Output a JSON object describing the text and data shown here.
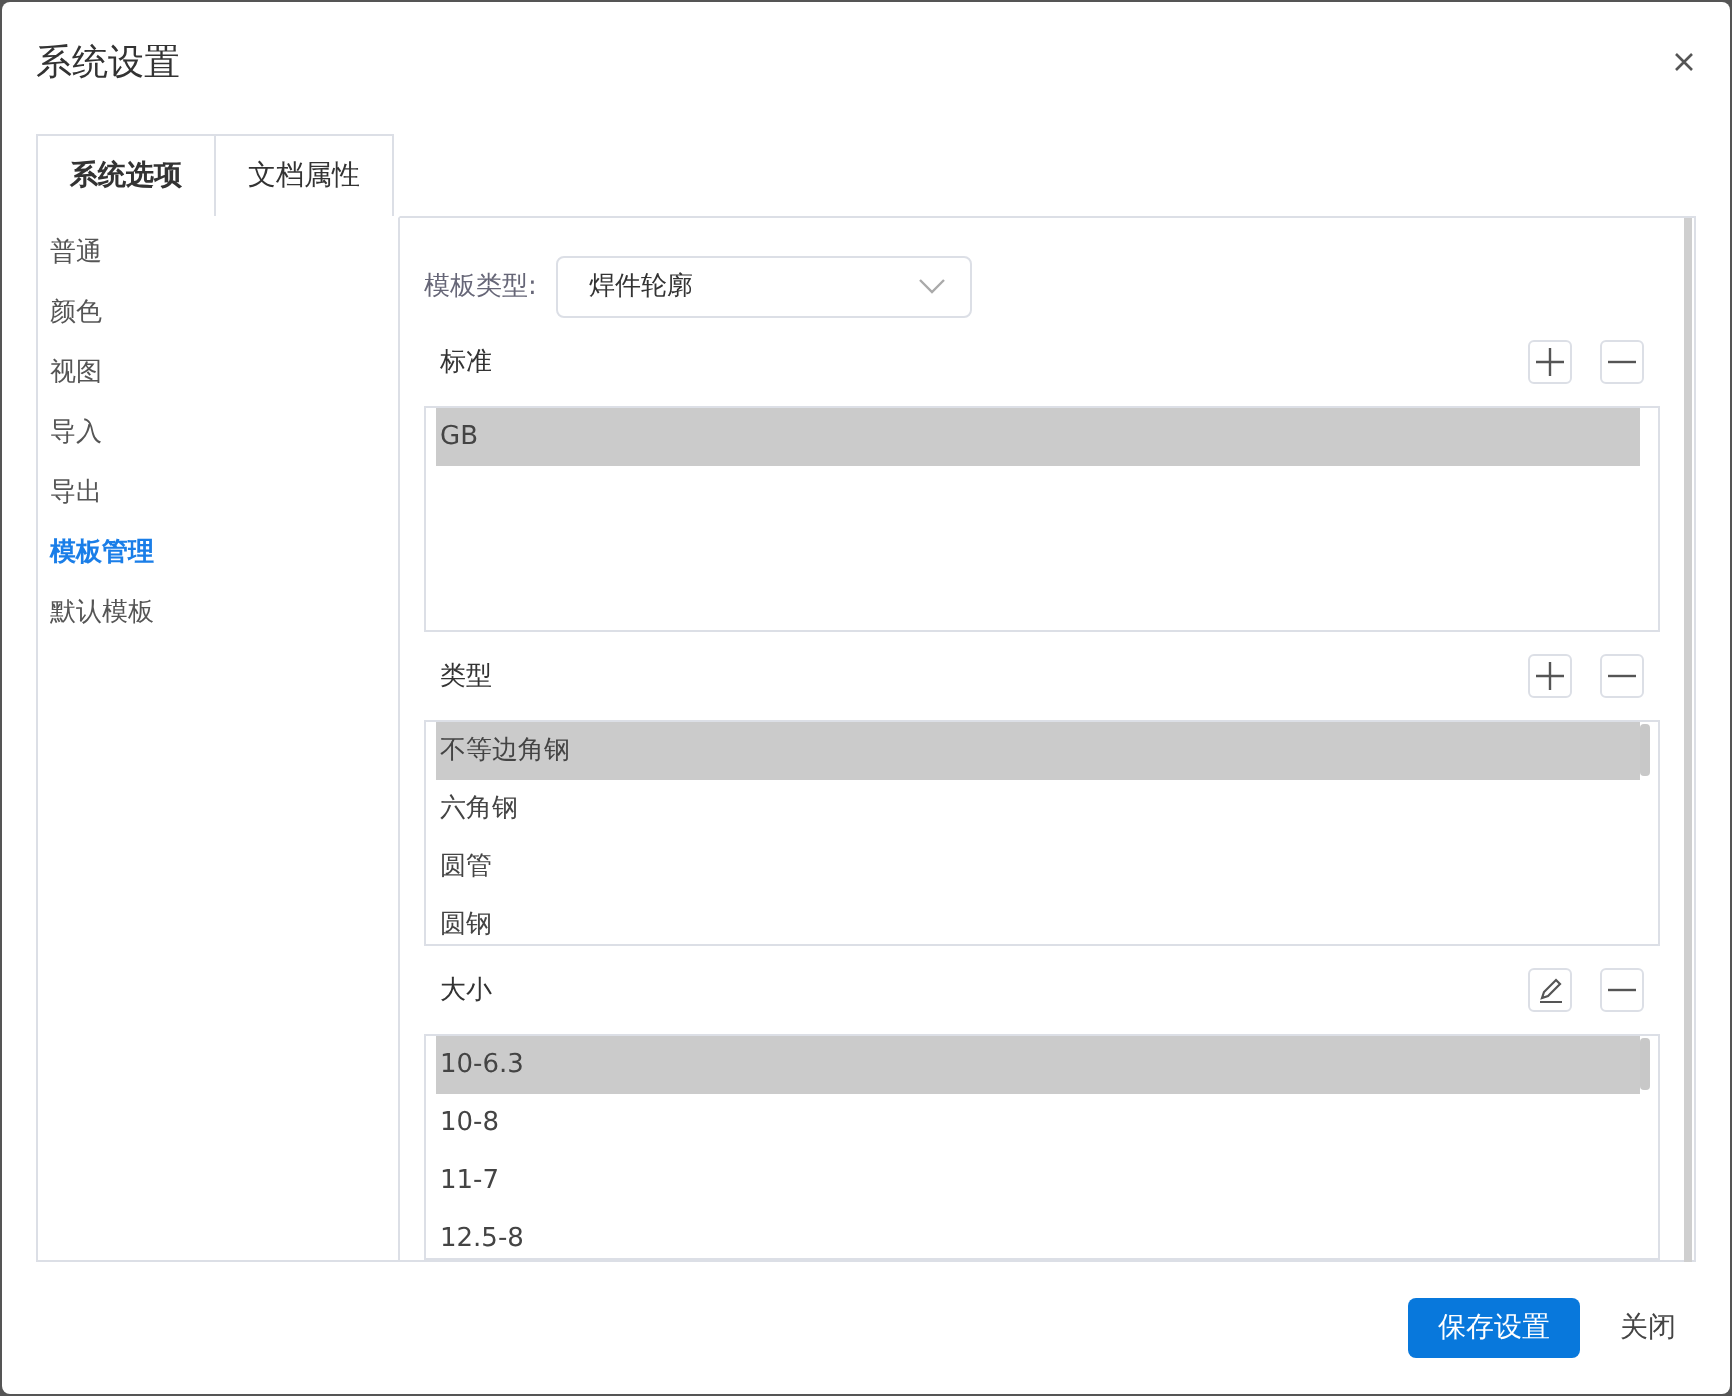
{
  "dialog": {
    "title": "系统设置"
  },
  "tabs": [
    {
      "label": "系统选项",
      "selected": true
    },
    {
      "label": "文档属性",
      "selected": false
    }
  ],
  "sidebar": {
    "items": [
      {
        "label": "普通",
        "selected": false
      },
      {
        "label": "颜色",
        "selected": false
      },
      {
        "label": "视图",
        "selected": false
      },
      {
        "label": "导入",
        "selected": false
      },
      {
        "label": "导出",
        "selected": false
      },
      {
        "label": "模板管理",
        "selected": true
      },
      {
        "label": "默认模板",
        "selected": false
      }
    ]
  },
  "template_type": {
    "label": "模板类型:",
    "value": "焊件轮廓"
  },
  "sections": [
    {
      "label": "标准",
      "actions": [
        {
          "kind": "add"
        },
        {
          "kind": "remove"
        }
      ],
      "rows": [
        {
          "text": "GB",
          "selected": true
        }
      ]
    },
    {
      "label": "类型",
      "actions": [
        {
          "kind": "add"
        },
        {
          "kind": "remove"
        }
      ],
      "rows": [
        {
          "text": "不等边角钢",
          "selected": true
        },
        {
          "text": "六角钢",
          "selected": false
        },
        {
          "text": "圆管",
          "selected": false
        },
        {
          "text": "圆钢",
          "selected": false
        }
      ]
    },
    {
      "label": "大小",
      "actions": [
        {
          "kind": "edit"
        },
        {
          "kind": "remove"
        }
      ],
      "rows": [
        {
          "text": "10-6.3",
          "selected": true
        },
        {
          "text": "10-8",
          "selected": false
        },
        {
          "text": "11-7",
          "selected": false
        },
        {
          "text": "12.5-8",
          "selected": false
        }
      ]
    }
  ],
  "buttons": [
    {
      "label": "保存设置",
      "kind": "primary"
    },
    {
      "label": "关闭",
      "kind": "plain"
    }
  ]
}
